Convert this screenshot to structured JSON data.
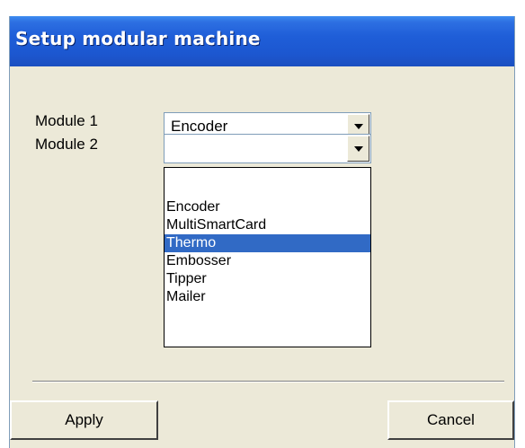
{
  "window": {
    "title": "Setup modular machine"
  },
  "form": {
    "module1": {
      "label": "Module 1",
      "value": "Encoder"
    },
    "module2": {
      "label": "Module 2",
      "value": "",
      "options": [
        "",
        "Encoder",
        "MultiSmartCard",
        "Thermo",
        "Embosser",
        "Tipper",
        "Mailer"
      ],
      "highlighted_option": "Thermo"
    }
  },
  "buttons": {
    "apply": "Apply",
    "cancel": "Cancel"
  },
  "icons": {
    "combo_arrow": "chevron-down-icon"
  },
  "colors": {
    "title_bar": "#1F5ED8",
    "title_text": "#FFFFFF",
    "dialog_background": "#ECE9D8",
    "selection": "#316AC5"
  }
}
